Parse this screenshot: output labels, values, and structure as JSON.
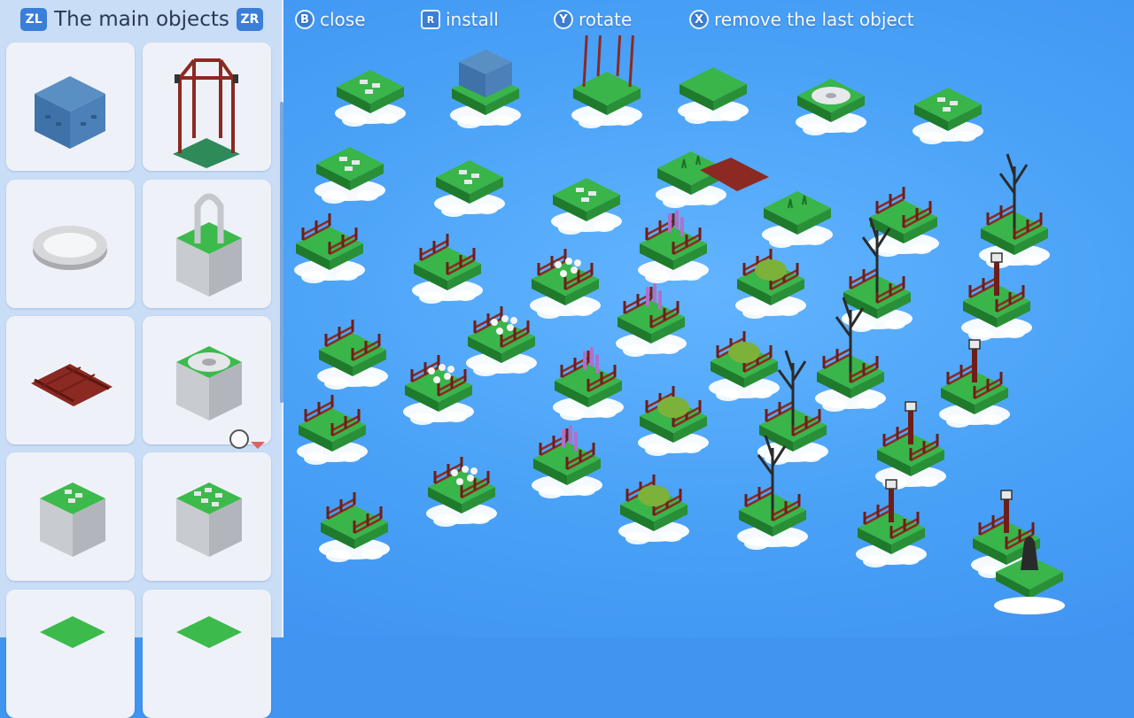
{
  "panel": {
    "title": "The main objects",
    "left_button": "ZL",
    "right_button": "ZR"
  },
  "hints": [
    {
      "button": "B",
      "label": "close"
    },
    {
      "button": "R",
      "label": "install"
    },
    {
      "button": "Y",
      "label": "rotate"
    },
    {
      "button": "X",
      "label": "remove the last object"
    }
  ],
  "catalog": [
    {
      "icon": "blue-block-icon"
    },
    {
      "icon": "swing-frame-icon"
    },
    {
      "icon": "stone-ring-icon"
    },
    {
      "icon": "stone-arch-icon"
    },
    {
      "icon": "wooden-bridge-icon"
    },
    {
      "icon": "circular-paving-tile-icon"
    },
    {
      "icon": "paved-grass-tile-icon"
    },
    {
      "icon": "paved-grass-tile-alt-icon"
    },
    {
      "icon": "grass-tile-partial-icon"
    },
    {
      "icon": "grass-tile-partial-alt-icon"
    }
  ],
  "colors": {
    "sky": "#4aa2f7",
    "grass": "#39b54a",
    "fence": "#8a2a22",
    "button_blue": "#3b7fd6"
  }
}
